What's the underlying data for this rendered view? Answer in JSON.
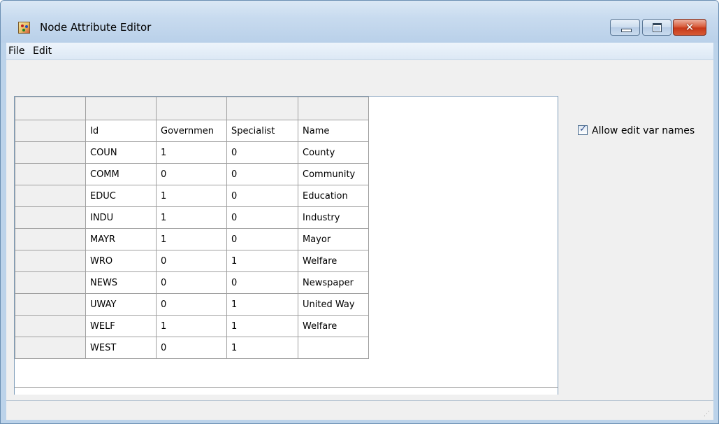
{
  "window": {
    "title": "Node Attribute Editor",
    "close_glyph": "✕"
  },
  "menu": {
    "items": [
      "File",
      "Edit"
    ]
  },
  "table": {
    "header_row": [
      "Id",
      "Governmen",
      "Specialist",
      "Name"
    ],
    "rows": [
      [
        "COUN",
        "1",
        "0",
        "County"
      ],
      [
        "COMM",
        "0",
        "0",
        "Community"
      ],
      [
        "EDUC",
        "1",
        "0",
        "Education"
      ],
      [
        "INDU",
        "1",
        "0",
        "Industry"
      ],
      [
        "MAYR",
        "1",
        "0",
        "Mayor"
      ],
      [
        "WRO",
        "0",
        "1",
        "Welfare"
      ],
      [
        "NEWS",
        "0",
        "0",
        "Newspaper"
      ],
      [
        "UWAY",
        "0",
        "1",
        "United Way"
      ],
      [
        "WELF",
        "1",
        "1",
        "Welfare"
      ],
      [
        "WEST",
        "0",
        "1",
        ""
      ]
    ]
  },
  "options": {
    "allow_edit_var_names": {
      "label": "Allow edit var names",
      "checked": true
    }
  },
  "icons": {
    "app": "app-icon",
    "minimize": "minimize-icon",
    "maximize": "maximize-icon",
    "close": "close-icon",
    "checkmark": "checkmark-icon",
    "resize_grip": "resize-grip-icon"
  },
  "colors": {
    "titlebar": "#c8dbef",
    "close_button": "#c7391a",
    "grid_border": "#a0a0a0",
    "row_header": "#f0f0f0"
  }
}
